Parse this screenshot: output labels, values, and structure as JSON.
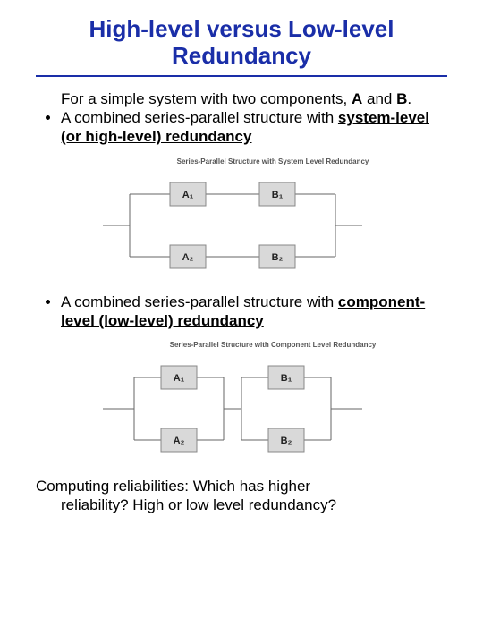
{
  "title": "High-level versus Low-level Redundancy",
  "intro": {
    "prefix": "For a simple system with two components, ",
    "a": "A",
    "mid": " and ",
    "b": "B",
    "suffix": "."
  },
  "bullet1": {
    "text": "A combined series-parallel structure with ",
    "emph": "system-level (or high-level) redundancy"
  },
  "bullet2": {
    "text": "A combined series-parallel structure with ",
    "emph": "component-level (low-level) redundancy"
  },
  "diagram1": {
    "title": "Series-Parallel Structure with System Level Redundancy",
    "boxes": [
      "A₁",
      "B₁",
      "A₂",
      "B₂"
    ]
  },
  "diagram2": {
    "title": "Series-Parallel Structure with Component Level Redundancy",
    "boxes": [
      "A₁",
      "B₁",
      "A₂",
      "B₂"
    ]
  },
  "footer": {
    "line1": "Computing reliabilities: Which has higher",
    "line2": "reliability? High or low level redundancy?"
  }
}
